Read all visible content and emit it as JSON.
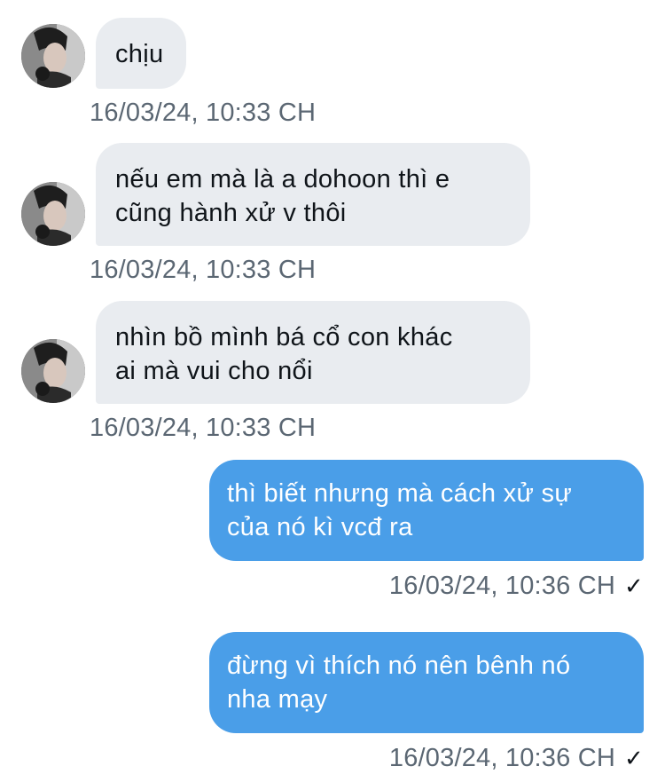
{
  "messages": [
    {
      "direction": "in",
      "lines": [
        "chịu"
      ],
      "timestamp": "16/03/24, 10:33 CH"
    },
    {
      "direction": "in",
      "lines": [
        "nếu em mà là a dohoon thì e",
        "cũng hành xử v thôi"
      ],
      "timestamp": "16/03/24, 10:33 CH"
    },
    {
      "direction": "in",
      "lines": [
        "nhìn bồ mình bá cổ con khác",
        "ai mà vui cho nổi"
      ],
      "timestamp": "16/03/24, 10:33 CH"
    },
    {
      "direction": "out",
      "lines": [
        "thì biết nhưng mà cách xử sự",
        "của nó kì vcđ ra"
      ],
      "timestamp": "16/03/24, 10:36 CH",
      "status_icon": "check-icon",
      "status_glyph": "✓"
    },
    {
      "direction": "out",
      "lines": [
        "đừng vì thích nó nên bênh nó",
        "nha mạy"
      ],
      "timestamp": "16/03/24, 10:36 CH",
      "status_icon": "check-icon",
      "status_glyph": "✓"
    }
  ],
  "colors": {
    "incoming_bubble": "#e9ecf0",
    "outgoing_bubble": "#4a9ee8",
    "timestamp": "#5b6773"
  }
}
